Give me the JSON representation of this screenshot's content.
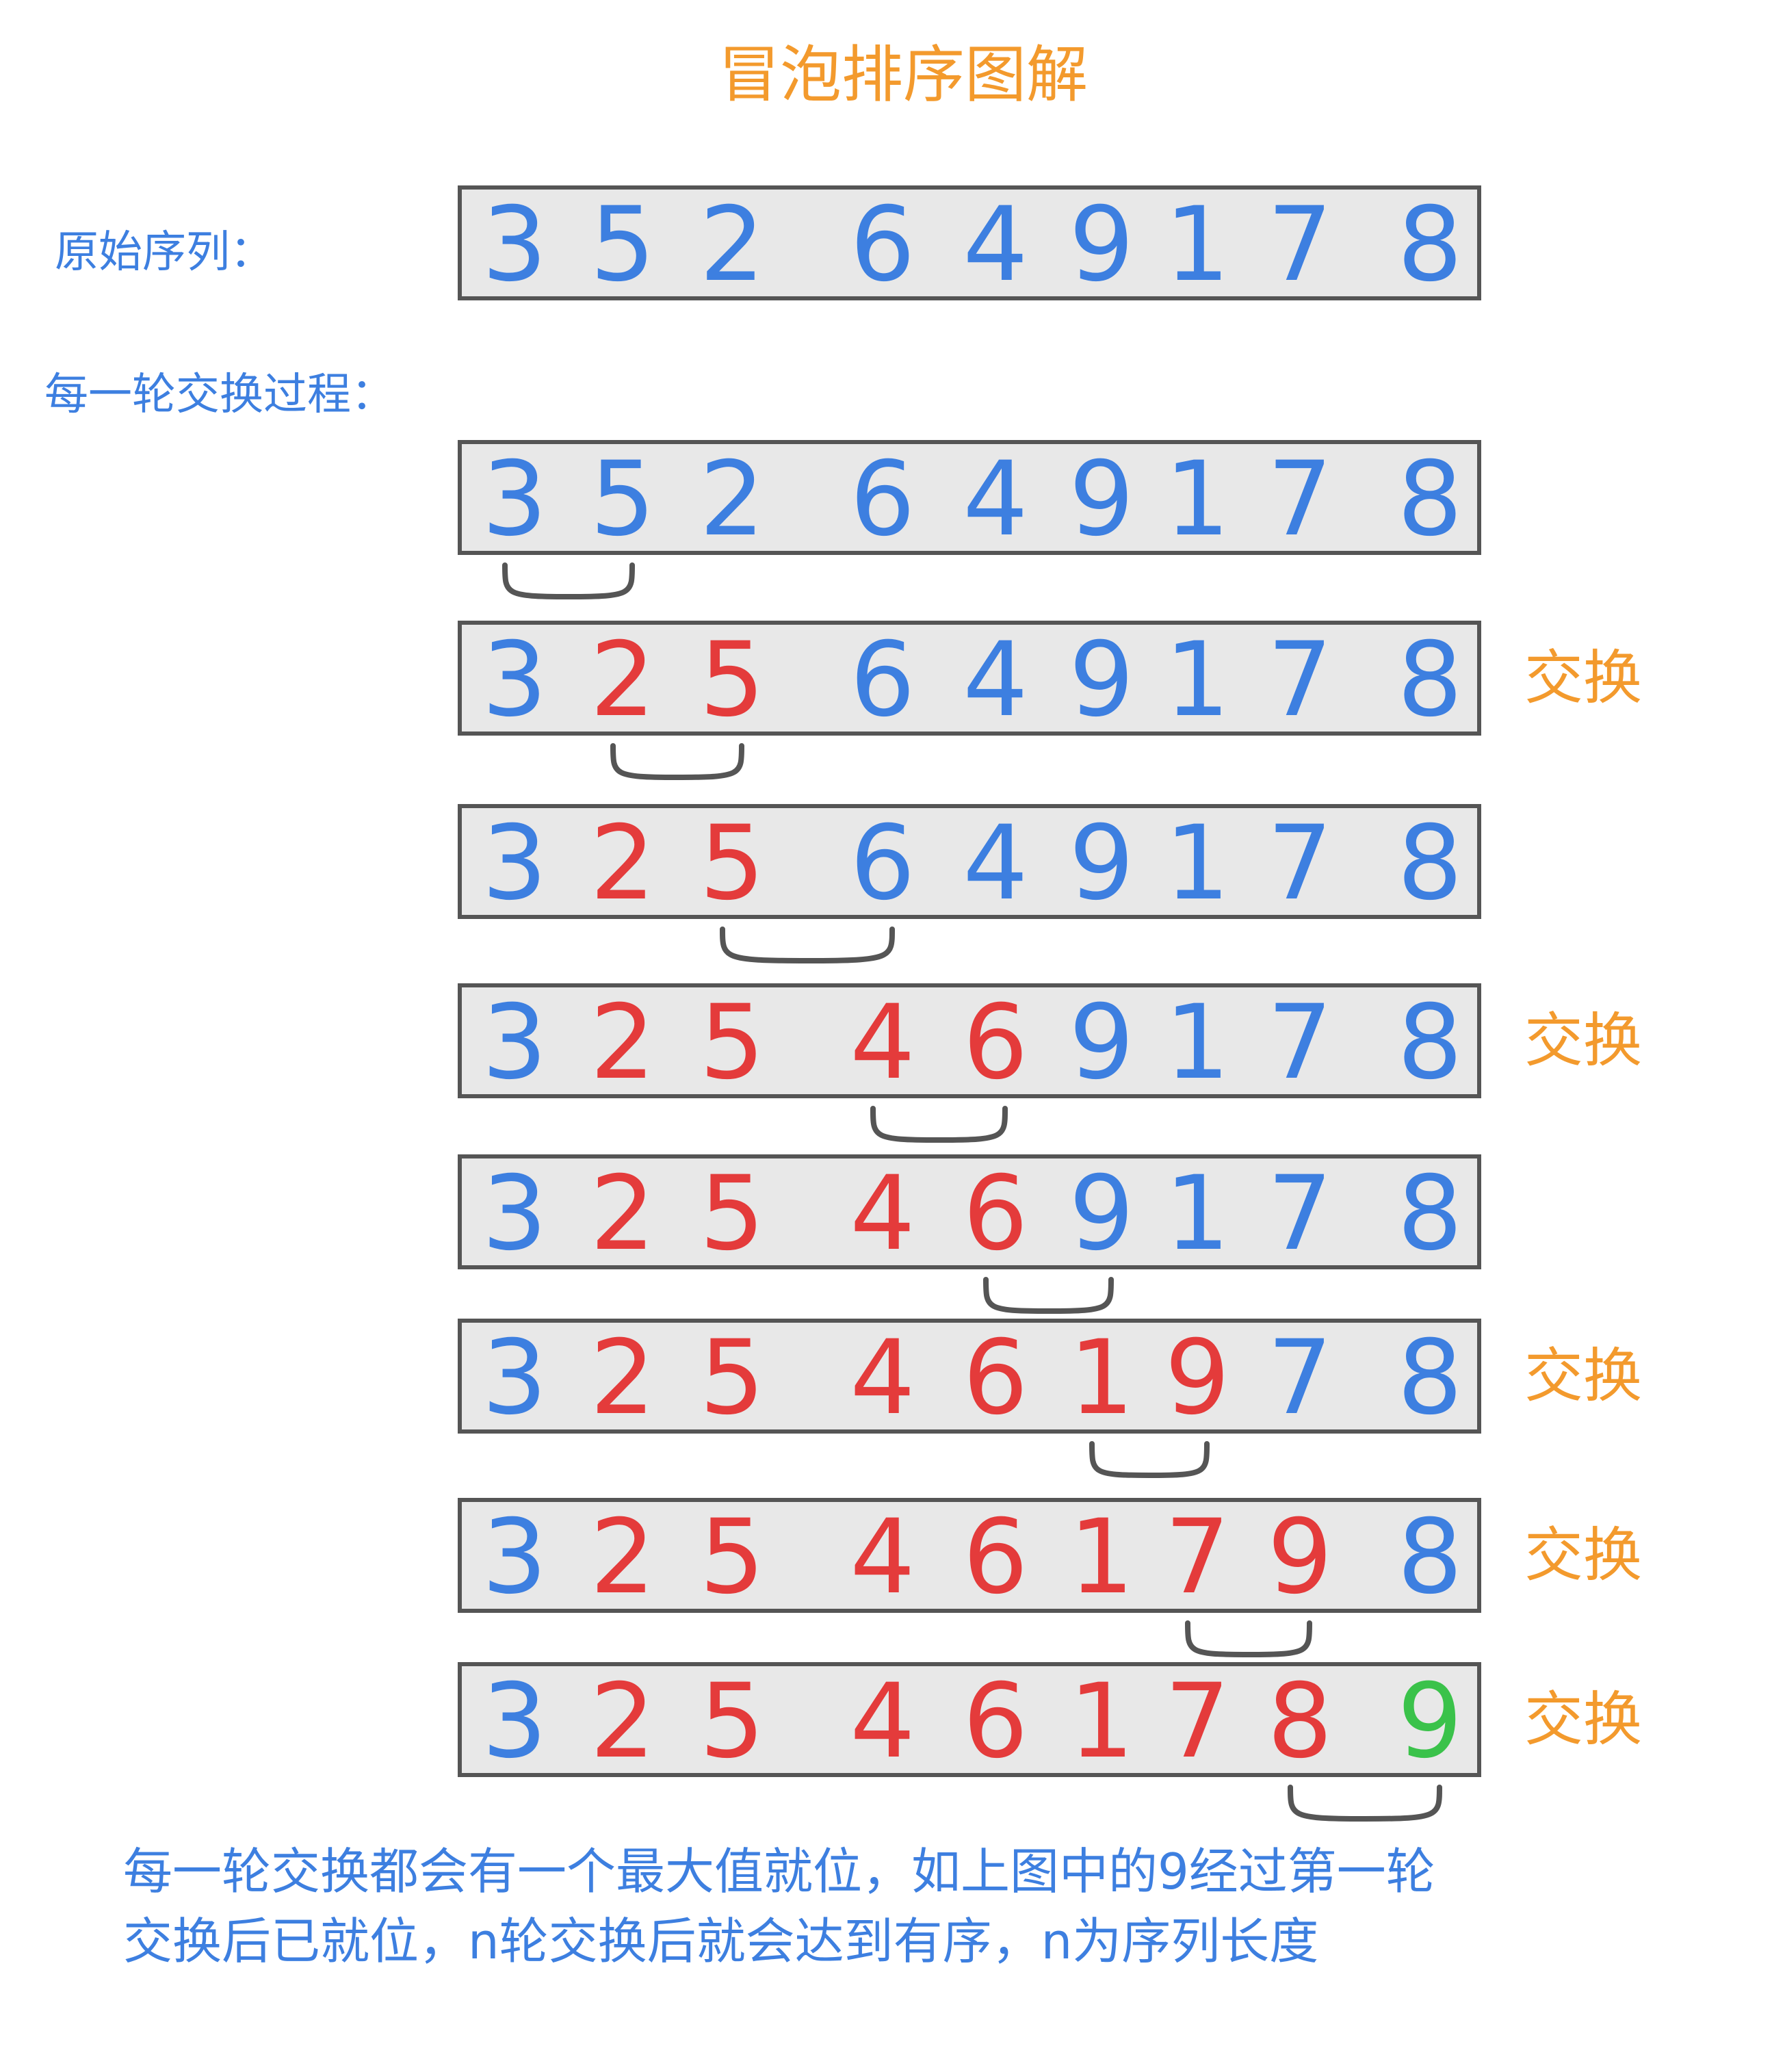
{
  "title": "冒泡排序图解",
  "original_label": "原始序列：",
  "rounds_label": "每一轮交换过程：",
  "swap_label": "交换",
  "note_lines": [
    "每一轮交换都会有一个最大值就位，如上图中的9经过第一轮",
    "交换后已就位，n轮交换后就会达到有序，n为序列长度"
  ],
  "colors": {
    "title": "#f39a2d",
    "label": "#3d7fe0",
    "swap": "#f39a2d",
    "digit_blue": "#3d7fe0",
    "digit_red": "#e43b3b",
    "digit_green": "#3ac24a",
    "box_fill": "#e8e8e8",
    "box_stroke": "#555555",
    "bracket": "#555555"
  },
  "original": {
    "digits": [
      "3",
      "5",
      "2",
      "6",
      "4",
      "9",
      "1",
      "7",
      "8"
    ],
    "colors": [
      "b",
      "b",
      "b",
      "b",
      "b",
      "b",
      "b",
      "b",
      "b"
    ]
  },
  "steps": [
    {
      "digits": [
        "3",
        "5",
        "2",
        "6",
        "4",
        "9",
        "1",
        "7",
        "8"
      ],
      "colors": [
        "b",
        "b",
        "b",
        "b",
        "b",
        "b",
        "b",
        "b",
        "b"
      ],
      "swap": false,
      "bracket": [
        0,
        1
      ]
    },
    {
      "digits": [
        "3",
        "2",
        "5",
        "6",
        "4",
        "9",
        "1",
        "7",
        "8"
      ],
      "colors": [
        "b",
        "r",
        "r",
        "b",
        "b",
        "b",
        "b",
        "b",
        "b"
      ],
      "swap": true,
      "bracket": [
        1,
        2
      ]
    },
    {
      "digits": [
        "3",
        "2",
        "5",
        "6",
        "4",
        "9",
        "1",
        "7",
        "8"
      ],
      "colors": [
        "b",
        "r",
        "r",
        "b",
        "b",
        "b",
        "b",
        "b",
        "b"
      ],
      "swap": false,
      "bracket": [
        2,
        3
      ]
    },
    {
      "digits": [
        "3",
        "2",
        "5",
        "4",
        "6",
        "9",
        "1",
        "7",
        "8"
      ],
      "colors": [
        "b",
        "r",
        "r",
        "r",
        "r",
        "b",
        "b",
        "b",
        "b"
      ],
      "swap": true,
      "bracket": [
        3,
        4
      ]
    },
    {
      "digits": [
        "3",
        "2",
        "5",
        "4",
        "6",
        "9",
        "1",
        "7",
        "8"
      ],
      "colors": [
        "b",
        "r",
        "r",
        "r",
        "r",
        "b",
        "b",
        "b",
        "b"
      ],
      "swap": false,
      "bracket": [
        4,
        5
      ]
    },
    {
      "digits": [
        "3",
        "2",
        "5",
        "4",
        "6",
        "1",
        "9",
        "7",
        "8"
      ],
      "colors": [
        "b",
        "r",
        "r",
        "r",
        "r",
        "r",
        "r",
        "b",
        "b"
      ],
      "swap": true,
      "bracket": [
        5,
        6
      ]
    },
    {
      "digits": [
        "3",
        "2",
        "5",
        "4",
        "6",
        "1",
        "7",
        "9",
        "8"
      ],
      "colors": [
        "b",
        "r",
        "r",
        "r",
        "r",
        "r",
        "r",
        "r",
        "b"
      ],
      "swap": true,
      "bracket": [
        6,
        7
      ]
    },
    {
      "digits": [
        "3",
        "2",
        "5",
        "4",
        "6",
        "1",
        "7",
        "8",
        "9"
      ],
      "colors": [
        "b",
        "r",
        "r",
        "r",
        "r",
        "r",
        "r",
        "r",
        "g"
      ],
      "swap": true,
      "bracket": [
        7,
        8
      ]
    }
  ]
}
